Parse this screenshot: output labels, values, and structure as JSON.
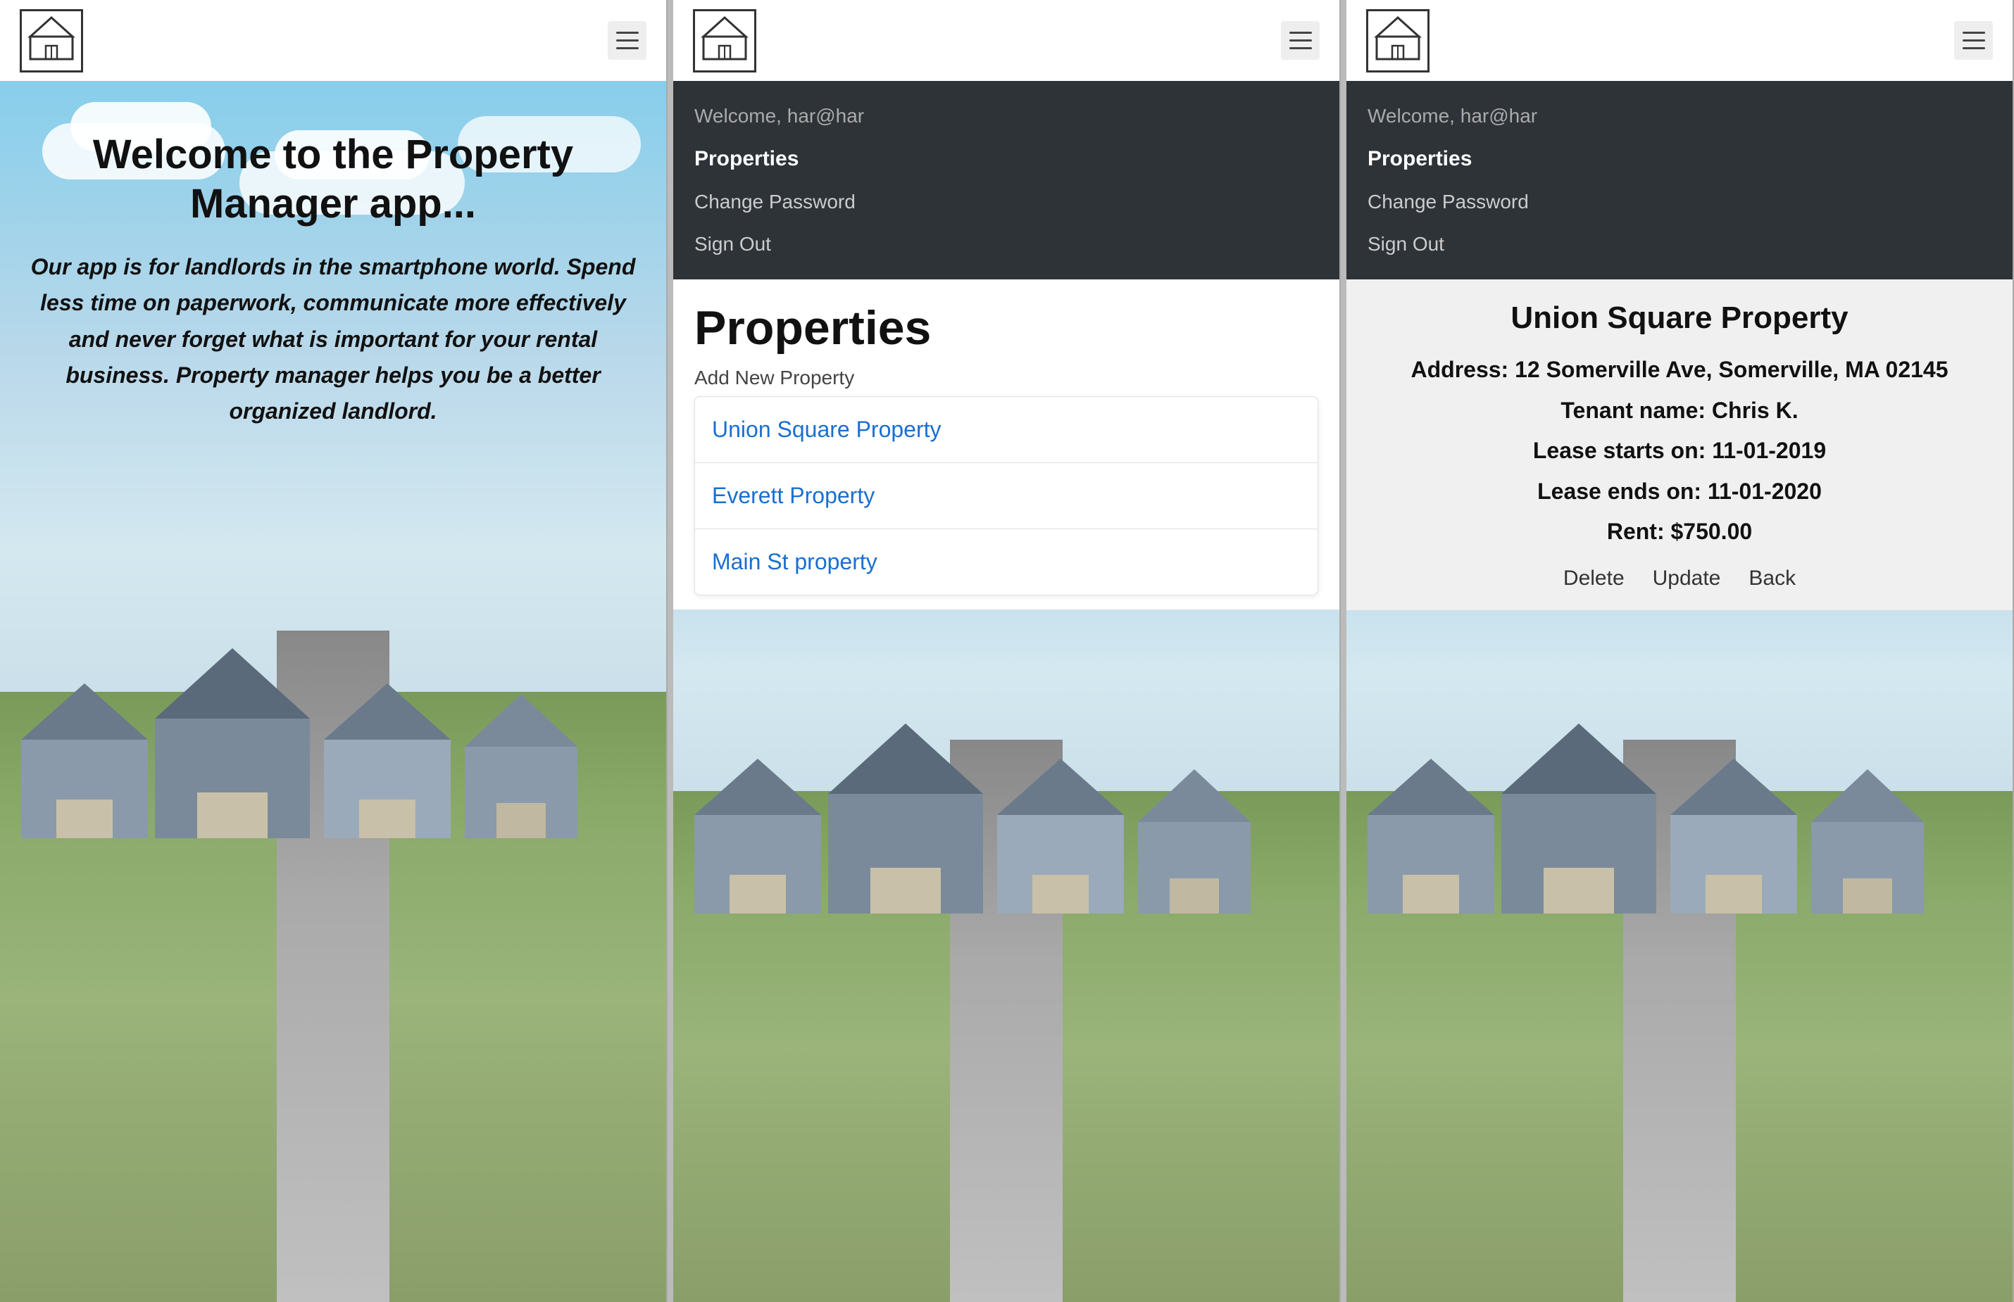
{
  "panel1": {
    "title": "Welcome to the Property Manager app...",
    "description": "Our app is for landlords in the smartphone world. Spend less time on paperwork, communicate more effectively and never forget what is important for your rental business. Property manager helps you be a better organized landlord."
  },
  "panel2": {
    "navbar": {
      "welcome": "Welcome, har@har"
    },
    "menu": {
      "welcome": "Welcome, har@har",
      "properties": "Properties",
      "change_password": "Change Password",
      "sign_out": "Sign Out"
    },
    "properties_title": "Properties",
    "add_new": "Add New Property",
    "properties_list": [
      {
        "name": "Union Square Property"
      },
      {
        "name": "Everett Property"
      },
      {
        "name": "Main St property"
      }
    ]
  },
  "panel3": {
    "menu": {
      "welcome": "Welcome, har@har",
      "properties": "Properties",
      "change_password": "Change Password",
      "sign_out": "Sign Out"
    },
    "detail": {
      "title": "Union Square Property",
      "address": "Address: 12 Somerville Ave, Somerville, MA 02145",
      "tenant": "Tenant name: Chris K.",
      "lease_start": "Lease starts on: 11-01-2019",
      "lease_end": "Lease ends on: 11-01-2020",
      "rent": "Rent: $750.00",
      "action_delete": "Delete",
      "action_update": "Update",
      "action_back": "Back"
    }
  },
  "icons": {
    "house": "house-icon",
    "hamburger": "hamburger-icon"
  }
}
